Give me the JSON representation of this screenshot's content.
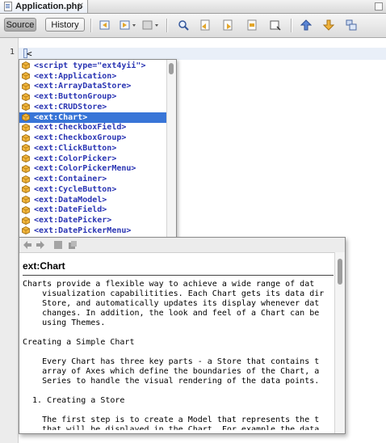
{
  "tab": {
    "title": "Application.php"
  },
  "toolbar": {
    "source_label": "Source",
    "history_label": "History",
    "icons": [
      "back-icon",
      "forward-dropdown-icon",
      "toggle-dropdown-icon",
      "find-icon",
      "find-previous-icon",
      "find-next-icon",
      "find-selection-icon",
      "toggle-highlight-icon",
      "shift-left-icon",
      "shift-right-icon",
      "comment-icon"
    ]
  },
  "editor": {
    "line_number": "1",
    "code": "<"
  },
  "completion": {
    "selected_index": 5,
    "items": [
      "<script type=\"ext4yii\">",
      "<ext:Application>",
      "<ext:ArrayDataStore>",
      "<ext:ButtonGroup>",
      "<ext:CRUDStore>",
      "<ext:Chart>",
      "<ext:CheckboxField>",
      "<ext:CheckboxGroup>",
      "<ext:ClickButton>",
      "<ext:ColorPicker>",
      "<ext:ColorPickerMenu>",
      "<ext:Container>",
      "<ext:CycleButton>",
      "<ext:DataModel>",
      "<ext:DateField>",
      "<ext:DatePicker>",
      "<ext:DatePickerMenu>"
    ]
  },
  "doc": {
    "title": "ext:Chart",
    "lines": [
      "Charts provide a flexible way to achieve a wide range of dat",
      "    visualization capabilitities. Each Chart gets its data dir",
      "    Store, and automatically updates its display whenever dat",
      "    changes. In addition, the look and feel of a Chart can be",
      "    using Themes.",
      "",
      "Creating a Simple Chart",
      "",
      "    Every Chart has three key parts - a Store that contains t",
      "    array of Axes which define the boundaries of the Chart, a",
      "    Series to handle the visual rendering of the data points.",
      "",
      "  1. Creating a Store",
      "",
      "    The first step is to create a Model that represents the t",
      "    that will be displayed in the Chart. For example the data"
    ]
  },
  "colors": {
    "selection": "#3875d7",
    "tag_text": "#2a35b3",
    "tag_icon": "#f2b53a"
  }
}
